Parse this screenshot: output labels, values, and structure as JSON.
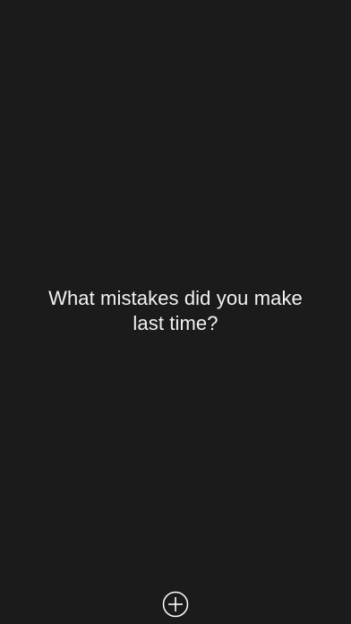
{
  "prompt": {
    "line1": "What mistakes did you make",
    "line2": "last time?"
  },
  "add_button": {
    "icon": "plus-circle-icon"
  },
  "colors": {
    "background": "#1b1b1b",
    "text": "#f2f2f2",
    "icon": "#ffffff"
  }
}
